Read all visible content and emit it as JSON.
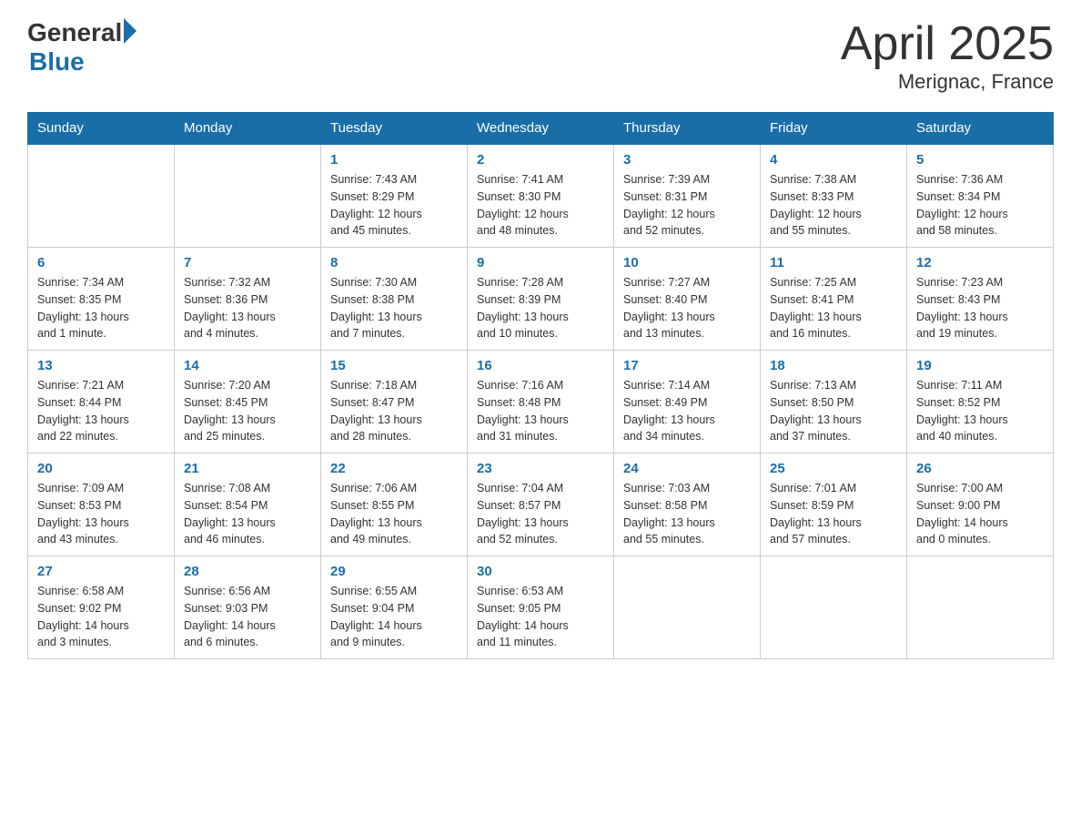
{
  "header": {
    "logo": {
      "general": "General",
      "blue": "Blue"
    },
    "title": "April 2025",
    "subtitle": "Merignac, France"
  },
  "calendar": {
    "weekdays": [
      "Sunday",
      "Monday",
      "Tuesday",
      "Wednesday",
      "Thursday",
      "Friday",
      "Saturday"
    ],
    "weeks": [
      [
        {
          "day": "",
          "info": ""
        },
        {
          "day": "",
          "info": ""
        },
        {
          "day": "1",
          "info": "Sunrise: 7:43 AM\nSunset: 8:29 PM\nDaylight: 12 hours\nand 45 minutes."
        },
        {
          "day": "2",
          "info": "Sunrise: 7:41 AM\nSunset: 8:30 PM\nDaylight: 12 hours\nand 48 minutes."
        },
        {
          "day": "3",
          "info": "Sunrise: 7:39 AM\nSunset: 8:31 PM\nDaylight: 12 hours\nand 52 minutes."
        },
        {
          "day": "4",
          "info": "Sunrise: 7:38 AM\nSunset: 8:33 PM\nDaylight: 12 hours\nand 55 minutes."
        },
        {
          "day": "5",
          "info": "Sunrise: 7:36 AM\nSunset: 8:34 PM\nDaylight: 12 hours\nand 58 minutes."
        }
      ],
      [
        {
          "day": "6",
          "info": "Sunrise: 7:34 AM\nSunset: 8:35 PM\nDaylight: 13 hours\nand 1 minute."
        },
        {
          "day": "7",
          "info": "Sunrise: 7:32 AM\nSunset: 8:36 PM\nDaylight: 13 hours\nand 4 minutes."
        },
        {
          "day": "8",
          "info": "Sunrise: 7:30 AM\nSunset: 8:38 PM\nDaylight: 13 hours\nand 7 minutes."
        },
        {
          "day": "9",
          "info": "Sunrise: 7:28 AM\nSunset: 8:39 PM\nDaylight: 13 hours\nand 10 minutes."
        },
        {
          "day": "10",
          "info": "Sunrise: 7:27 AM\nSunset: 8:40 PM\nDaylight: 13 hours\nand 13 minutes."
        },
        {
          "day": "11",
          "info": "Sunrise: 7:25 AM\nSunset: 8:41 PM\nDaylight: 13 hours\nand 16 minutes."
        },
        {
          "day": "12",
          "info": "Sunrise: 7:23 AM\nSunset: 8:43 PM\nDaylight: 13 hours\nand 19 minutes."
        }
      ],
      [
        {
          "day": "13",
          "info": "Sunrise: 7:21 AM\nSunset: 8:44 PM\nDaylight: 13 hours\nand 22 minutes."
        },
        {
          "day": "14",
          "info": "Sunrise: 7:20 AM\nSunset: 8:45 PM\nDaylight: 13 hours\nand 25 minutes."
        },
        {
          "day": "15",
          "info": "Sunrise: 7:18 AM\nSunset: 8:47 PM\nDaylight: 13 hours\nand 28 minutes."
        },
        {
          "day": "16",
          "info": "Sunrise: 7:16 AM\nSunset: 8:48 PM\nDaylight: 13 hours\nand 31 minutes."
        },
        {
          "day": "17",
          "info": "Sunrise: 7:14 AM\nSunset: 8:49 PM\nDaylight: 13 hours\nand 34 minutes."
        },
        {
          "day": "18",
          "info": "Sunrise: 7:13 AM\nSunset: 8:50 PM\nDaylight: 13 hours\nand 37 minutes."
        },
        {
          "day": "19",
          "info": "Sunrise: 7:11 AM\nSunset: 8:52 PM\nDaylight: 13 hours\nand 40 minutes."
        }
      ],
      [
        {
          "day": "20",
          "info": "Sunrise: 7:09 AM\nSunset: 8:53 PM\nDaylight: 13 hours\nand 43 minutes."
        },
        {
          "day": "21",
          "info": "Sunrise: 7:08 AM\nSunset: 8:54 PM\nDaylight: 13 hours\nand 46 minutes."
        },
        {
          "day": "22",
          "info": "Sunrise: 7:06 AM\nSunset: 8:55 PM\nDaylight: 13 hours\nand 49 minutes."
        },
        {
          "day": "23",
          "info": "Sunrise: 7:04 AM\nSunset: 8:57 PM\nDaylight: 13 hours\nand 52 minutes."
        },
        {
          "day": "24",
          "info": "Sunrise: 7:03 AM\nSunset: 8:58 PM\nDaylight: 13 hours\nand 55 minutes."
        },
        {
          "day": "25",
          "info": "Sunrise: 7:01 AM\nSunset: 8:59 PM\nDaylight: 13 hours\nand 57 minutes."
        },
        {
          "day": "26",
          "info": "Sunrise: 7:00 AM\nSunset: 9:00 PM\nDaylight: 14 hours\nand 0 minutes."
        }
      ],
      [
        {
          "day": "27",
          "info": "Sunrise: 6:58 AM\nSunset: 9:02 PM\nDaylight: 14 hours\nand 3 minutes."
        },
        {
          "day": "28",
          "info": "Sunrise: 6:56 AM\nSunset: 9:03 PM\nDaylight: 14 hours\nand 6 minutes."
        },
        {
          "day": "29",
          "info": "Sunrise: 6:55 AM\nSunset: 9:04 PM\nDaylight: 14 hours\nand 9 minutes."
        },
        {
          "day": "30",
          "info": "Sunrise: 6:53 AM\nSunset: 9:05 PM\nDaylight: 14 hours\nand 11 minutes."
        },
        {
          "day": "",
          "info": ""
        },
        {
          "day": "",
          "info": ""
        },
        {
          "day": "",
          "info": ""
        }
      ]
    ]
  }
}
